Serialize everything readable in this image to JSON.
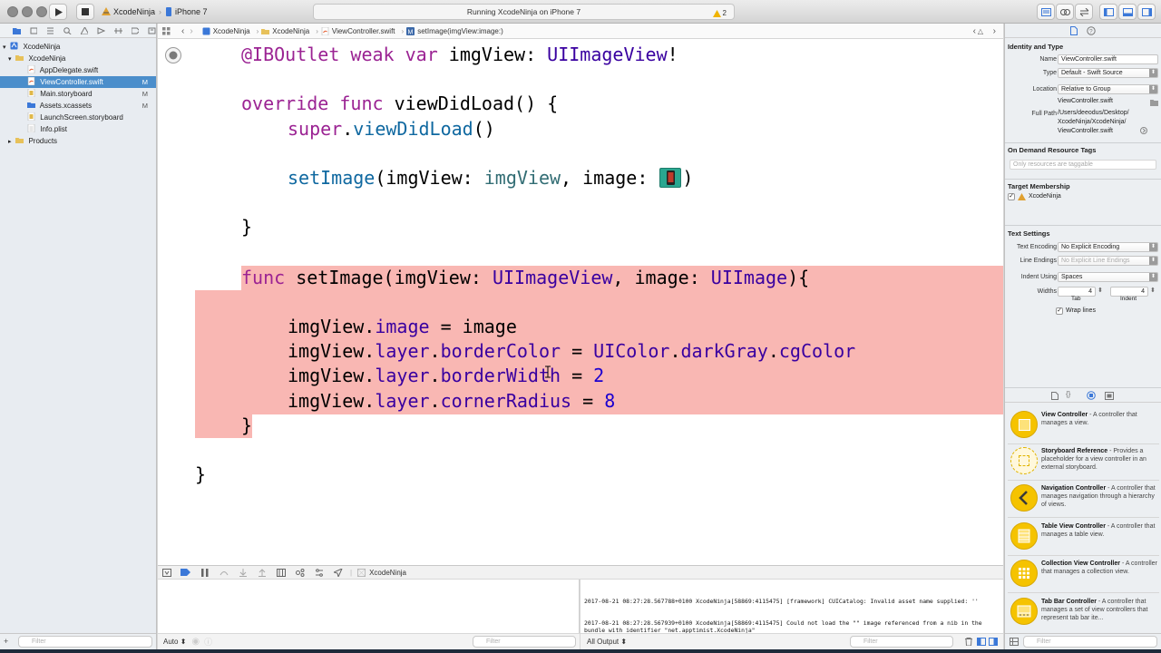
{
  "window": {
    "scheme_target": "XcodeNinja",
    "device": "iPhone 7",
    "activity_status": "Running XcodeNinja on iPhone 7",
    "warning_count": "2"
  },
  "navigator": {
    "items": [
      {
        "label": "XcodeNinja",
        "badge": "",
        "level": 0,
        "kind": "project"
      },
      {
        "label": "XcodeNinja",
        "badge": "",
        "level": 1,
        "kind": "folder"
      },
      {
        "label": "AppDelegate.swift",
        "badge": "",
        "level": 2,
        "kind": "swift"
      },
      {
        "label": "ViewController.swift",
        "badge": "M",
        "level": 2,
        "kind": "swift",
        "selected": true
      },
      {
        "label": "Main.storyboard",
        "badge": "M",
        "level": 2,
        "kind": "storyboard"
      },
      {
        "label": "Assets.xcassets",
        "badge": "M",
        "level": 2,
        "kind": "assets"
      },
      {
        "label": "LaunchScreen.storyboard",
        "badge": "",
        "level": 2,
        "kind": "storyboard"
      },
      {
        "label": "Info.plist",
        "badge": "",
        "level": 2,
        "kind": "plist"
      },
      {
        "label": "Products",
        "badge": "",
        "level": 1,
        "kind": "folder"
      }
    ],
    "filter_placeholder": "Filter"
  },
  "jumpbar": {
    "crumbs": [
      "XcodeNinja",
      "XcodeNinja",
      "ViewController.swift",
      "setImage(imgView:image:)"
    ]
  },
  "code": {
    "l1": {
      "a": "@IBOutlet weak var",
      "b": " imgView: ",
      "c": "UIImageView",
      "d": "!"
    },
    "l2": {
      "a": "override func",
      "b": " viewDidLoad() {"
    },
    "l3": {
      "a": "super",
      "b": ".",
      "c": "viewDidLoad",
      "d": "()"
    },
    "l4": {
      "a": "setImage",
      "b": "(imgView: ",
      "c": "imgView",
      "d": ", image: ",
      "e": ")"
    },
    "l5": "}",
    "l6": {
      "a": "func",
      "b": " setImage(imgView: ",
      "c": "UIImageView",
      "d": ", image: ",
      "e": "UIImage",
      "f": "){"
    },
    "l7": {
      "a": "imgView.",
      "b": "image",
      "c": " = image"
    },
    "l8": {
      "a": "imgView.",
      "b": "layer",
      "c": ".",
      "d": "borderColor",
      "e": " = ",
      "f": "UIColor",
      "g": ".",
      "h": "darkGray",
      "i": ".",
      "j": "cgColor"
    },
    "l9": {
      "a": "imgView.",
      "b": "layer",
      "c": ".",
      "d": "borderWidth",
      "e": " = ",
      "f": "2"
    },
    "l10": {
      "a": "imgView.",
      "b": "layer",
      "c": ".",
      "d": "cornerRadius",
      "e": " = ",
      "f": "8"
    },
    "l11": "}",
    "l12": "}"
  },
  "debug": {
    "target": "XcodeNinja",
    "auto_label": "Auto",
    "output_label": "All Output",
    "filter_placeholder": "Filter",
    "console_lines": [
      "2017-08-21 08:27:28.567788+0100 XcodeNinja[58869:4115475] [framework] CUICatalog: Invalid asset name supplied: ''",
      "2017-08-21 08:27:28.567939+0100 XcodeNinja[58869:4115475] Could not load the \"\" image referenced from a nib in the bundle with identifier \"net.apptimist.XcodeNinja\""
    ]
  },
  "inspector": {
    "identity_title": "Identity and Type",
    "name_label": "Name",
    "name_value": "ViewController.swift",
    "type_label": "Type",
    "type_value": "Default - Swift Source",
    "location_label": "Location",
    "location_value": "Relative to Group",
    "location_file": "ViewController.swift",
    "full_path_label": "Full Path",
    "full_path_value": "/Users/deeodus/Desktop/ XcodeNinja/XcodeNinja/ ViewController.swift",
    "odr_title": "On Demand Resource Tags",
    "odr_placeholder": "Only resources are taggable",
    "target_title": "Target Membership",
    "target_name": "XcodeNinja",
    "text_settings_title": "Text Settings",
    "encoding_label": "Text Encoding",
    "encoding_value": "No Explicit Encoding",
    "endings_label": "Line Endings",
    "endings_value": "No Explicit Line Endings",
    "indent_label": "Indent Using",
    "indent_value": "Spaces",
    "widths_label": "Widths",
    "tab_value": "4",
    "indent_width_value": "4",
    "tab_caption": "Tab",
    "indent_caption": "Indent",
    "wrap_label": "Wrap lines",
    "filter_placeholder": "Filter"
  },
  "library": [
    {
      "title": "View Controller",
      "desc": " - A controller that manages a view."
    },
    {
      "title": "Storyboard Reference",
      "desc": " - Provides a placeholder for a view controller in an external storyboard."
    },
    {
      "title": "Navigation Controller",
      "desc": " - A controller that manages navigation through a hierarchy of views."
    },
    {
      "title": "Table View Controller",
      "desc": " - A controller that manages a table view."
    },
    {
      "title": "Collection View Controller",
      "desc": " - A controller that manages a collection view."
    },
    {
      "title": "Tab Bar Controller",
      "desc": " - A controller that manages a set of view controllers that represent tab bar ite..."
    }
  ],
  "colors": {
    "breakpoint_highlight": "#f9b7b3",
    "selection": "#4b8ecb",
    "library_icon": "#f5c300"
  }
}
